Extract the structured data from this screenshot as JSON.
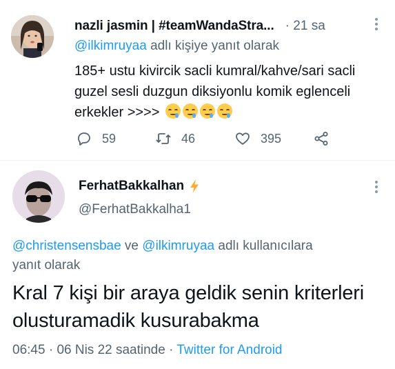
{
  "tweet1": {
    "display_name": "nazli jasmin | #teamWandaStra...",
    "time": "· 21 sa",
    "reply_mention": "@ilkimruyaa",
    "reply_suffix": " adlı kişiye yanıt olarak",
    "text": "185+ ustu kivircik sacli kumral/kahve/sari sacli guzel sesli duzgun diksiyonlu komik eglenceli erkekler >>>>",
    "emoji_icon": "drooling-face-icon",
    "emoji_count": 4,
    "reply_count": "59",
    "retweet_count": "46",
    "like_count": "395"
  },
  "tweet2": {
    "display_name": "FerhatBakkalhan",
    "handle": "@FerhatBakkalha1",
    "reply_mention_1": "@christensensbae",
    "reply_connector": " ve ",
    "reply_mention_2": "@ilkimruyaa",
    "reply_suffix_1": " adlı kullanıcılara",
    "reply_suffix_2": "yanıt olarak",
    "text": "Kral 7 kişi bir araya geldik senin kriterleri olusturamadik kusurabakma",
    "time": "06:45",
    "separator": " · ",
    "date": "06 Nis 22 saatinde",
    "source": "Twitter for Android"
  },
  "colors": {
    "text": "#0f1419",
    "secondary": "#536471",
    "link": "#1d9bf0",
    "bolt": "#ffac33"
  }
}
